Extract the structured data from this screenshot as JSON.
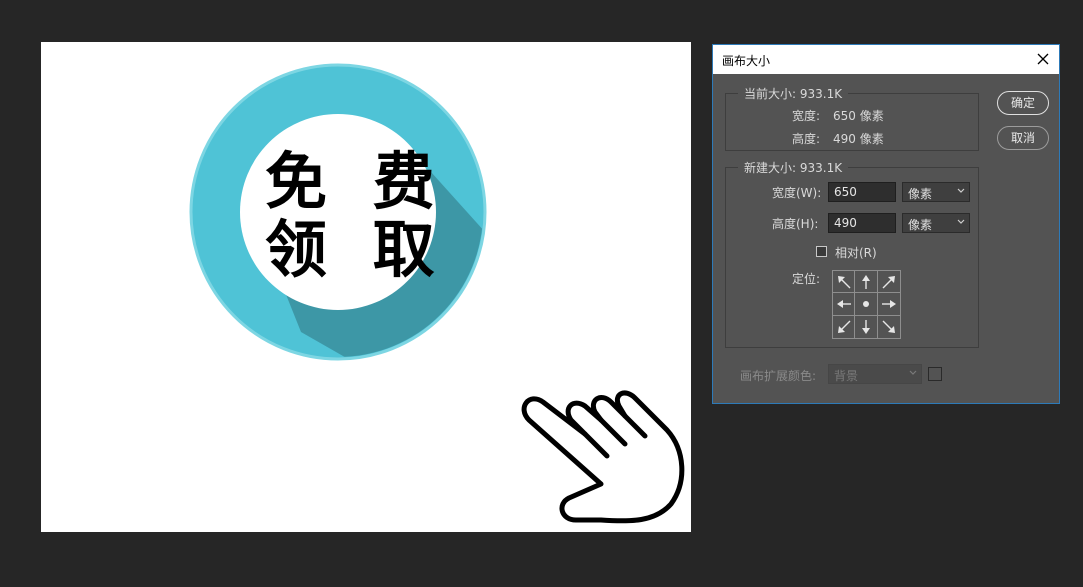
{
  "canvas": {
    "badge_line1": "免 费",
    "badge_line2": "领 取"
  },
  "dialog": {
    "title": "画布大小",
    "ok_label": "确定",
    "cancel_label": "取消",
    "current_size": {
      "legend": "当前大小: 933.1K",
      "width_label": "宽度:",
      "width_value": "650 像素",
      "height_label": "高度:",
      "height_value": "490 像素"
    },
    "new_size": {
      "legend": "新建大小: 933.1K",
      "width_label": "宽度(W):",
      "width_value": "650",
      "width_unit": "像素",
      "height_label": "高度(H):",
      "height_value": "490",
      "height_unit": "像素",
      "relative_label": "相对(R)",
      "relative_checked": false,
      "anchor_label": "定位:"
    },
    "extension_color_label": "画布扩展颜色:",
    "extension_color_value": "背景"
  },
  "colors": {
    "badge_ring": "#52c5d8",
    "badge_shadow": "#3d97a6",
    "dialog_bg": "#535353",
    "app_bg": "#262626",
    "dialog_border": "#2d7ab8"
  }
}
